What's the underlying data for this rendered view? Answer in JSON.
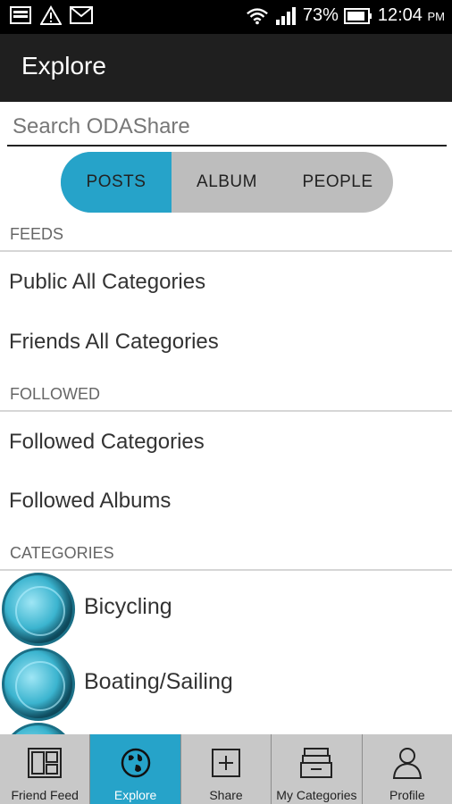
{
  "status_bar": {
    "battery": "73%",
    "time": "12:04",
    "ampm": "PM",
    "left_icons": [
      "image-notification-icon",
      "warning-icon",
      "gmail-icon"
    ],
    "right_icons": [
      "wifi-icon",
      "signal-icon",
      "battery-icon"
    ]
  },
  "action_bar": {
    "title": "Explore"
  },
  "search": {
    "placeholder": "Search ODAShare",
    "value": ""
  },
  "segment": {
    "tabs": [
      {
        "label": "POSTS",
        "active": true
      },
      {
        "label": "ALBUM",
        "active": false
      },
      {
        "label": "PEOPLE",
        "active": false
      }
    ],
    "accent": "#26a3c9"
  },
  "feeds": {
    "header": "FEEDS",
    "items": [
      "Public All Categories",
      "Friends All Categories"
    ]
  },
  "followed": {
    "header": "FOLLOWED",
    "items": [
      "Followed Categories",
      "Followed Albums"
    ]
  },
  "categories": {
    "header": "CATEGORIES",
    "items": [
      {
        "label": "Bicycling",
        "icon": "bicycling-icon"
      },
      {
        "label": "Boating/Sailing",
        "icon": "boating-icon"
      }
    ]
  },
  "bottom_nav": {
    "items": [
      {
        "label": "Friend Feed",
        "icon": "friend-feed-icon",
        "active": false
      },
      {
        "label": "Explore",
        "icon": "globe-icon",
        "active": true
      },
      {
        "label": "Share",
        "icon": "plus-box-icon",
        "active": false
      },
      {
        "label": "My Categories",
        "icon": "stack-icon",
        "active": false
      },
      {
        "label": "Profile",
        "icon": "person-icon",
        "active": false
      }
    ]
  }
}
